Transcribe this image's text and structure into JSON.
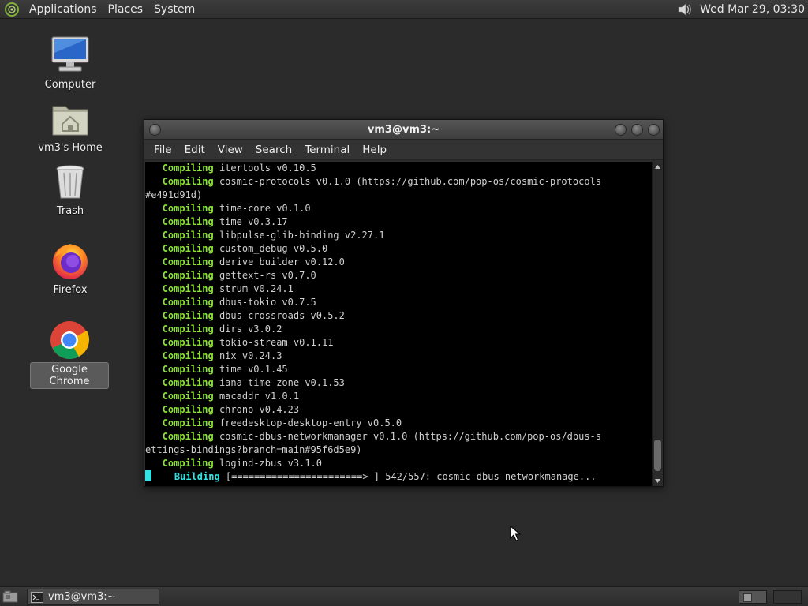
{
  "top_panel": {
    "menus": [
      "Applications",
      "Places",
      "System"
    ],
    "clock": "Wed Mar 29, 03:30"
  },
  "desktop_icons": [
    {
      "label": "Computer",
      "icon": "computer-icon"
    },
    {
      "label": "vm3's Home",
      "icon": "home-folder-icon"
    },
    {
      "label": "Trash",
      "icon": "trash-icon"
    },
    {
      "label": "Firefox",
      "icon": "firefox-icon"
    },
    {
      "label": "Google Chrome",
      "icon": "chrome-icon"
    }
  ],
  "terminal": {
    "title": "vm3@vm3:~",
    "menus": [
      "File",
      "Edit",
      "View",
      "Search",
      "Terminal",
      "Help"
    ],
    "lines": [
      {
        "kw": "Compiling",
        "text": " itertools v0.10.5"
      },
      {
        "kw": "Compiling",
        "text": " cosmic-protocols v0.1.0 (https://github.com/pop-os/cosmic-protocols"
      },
      {
        "kw": "",
        "text": "#e491d91d)"
      },
      {
        "kw": "Compiling",
        "text": " time-core v0.1.0"
      },
      {
        "kw": "Compiling",
        "text": " time v0.3.17"
      },
      {
        "kw": "Compiling",
        "text": " libpulse-glib-binding v2.27.1"
      },
      {
        "kw": "Compiling",
        "text": " custom_debug v0.5.0"
      },
      {
        "kw": "Compiling",
        "text": " derive_builder v0.12.0"
      },
      {
        "kw": "Compiling",
        "text": " gettext-rs v0.7.0"
      },
      {
        "kw": "Compiling",
        "text": " strum v0.24.1"
      },
      {
        "kw": "Compiling",
        "text": " dbus-tokio v0.7.5"
      },
      {
        "kw": "Compiling",
        "text": " dbus-crossroads v0.5.2"
      },
      {
        "kw": "Compiling",
        "text": " dirs v3.0.2"
      },
      {
        "kw": "Compiling",
        "text": " tokio-stream v0.1.11"
      },
      {
        "kw": "Compiling",
        "text": " nix v0.24.3"
      },
      {
        "kw": "Compiling",
        "text": " time v0.1.45"
      },
      {
        "kw": "Compiling",
        "text": " iana-time-zone v0.1.53"
      },
      {
        "kw": "Compiling",
        "text": " macaddr v1.0.1"
      },
      {
        "kw": "Compiling",
        "text": " chrono v0.4.23"
      },
      {
        "kw": "Compiling",
        "text": " freedesktop-desktop-entry v0.5.0"
      },
      {
        "kw": "Compiling",
        "text": " cosmic-dbus-networkmanager v0.1.0 (https://github.com/pop-os/dbus-s"
      },
      {
        "kw": "",
        "text": "ettings-bindings?branch=main#95f6d5e9)"
      },
      {
        "kw": "Compiling",
        "text": " logind-zbus v3.1.0"
      }
    ],
    "building": {
      "kw": "Building",
      "text": " [=======================> ] 542/557: cosmic-dbus-networkmanage..."
    }
  },
  "taskbar": {
    "task_label": "vm3@vm3:~"
  }
}
